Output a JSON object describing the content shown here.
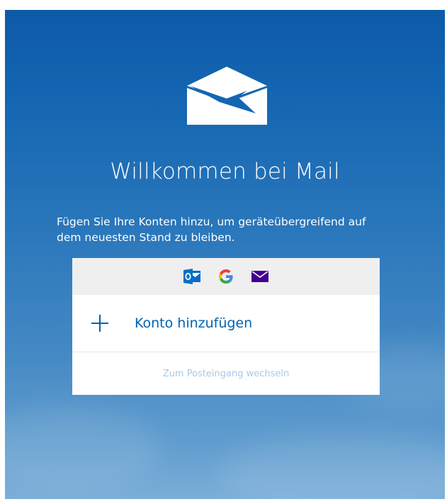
{
  "welcome": {
    "title": "Willkommen bei Mail",
    "subtitle_line1": "Fügen Sie Ihre Konten hinzu, um geräteübergreifend auf",
    "subtitle_line2": "dem neuesten Stand zu bleiben."
  },
  "providers": [
    {
      "name": "outlook-icon",
      "color": "#0072c6"
    },
    {
      "name": "google-icon",
      "color": "#4285f4"
    },
    {
      "name": "yahoo-mail-icon",
      "color": "#410093"
    }
  ],
  "actions": {
    "add_account_label": "Konto hinzufügen",
    "go_to_inbox_label": "Zum Posteingang wechseln"
  },
  "colors": {
    "accent": "#0063b1",
    "background_top": "#0d5aa8",
    "background_bottom": "#7aaed8"
  }
}
